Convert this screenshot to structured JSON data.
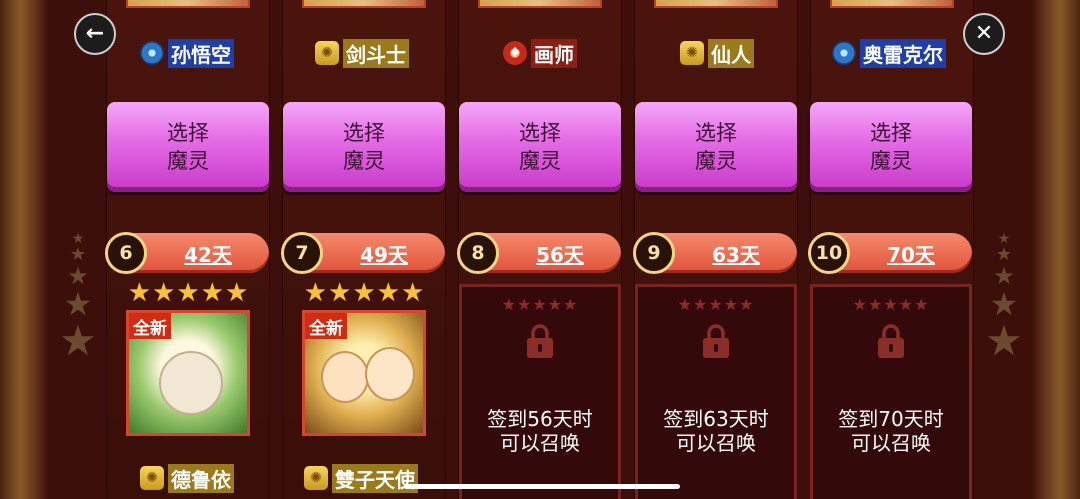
{
  "nav": {
    "back_icon": "←",
    "close_icon": "✕"
  },
  "top_heroes": [
    {
      "name": "孙悟空",
      "element": "water",
      "tint": "blue"
    },
    {
      "name": "剑斗士",
      "element": "light",
      "tint": "gold"
    },
    {
      "name": "画师",
      "element": "fire",
      "tint": "red"
    },
    {
      "name": "仙人",
      "element": "light",
      "tint": "gold"
    },
    {
      "name": "奥雷克尔",
      "element": "water",
      "tint": "blue"
    }
  ],
  "select_button": {
    "line1": "选择",
    "line2": "魔灵"
  },
  "days": [
    {
      "num": "6",
      "label": "42天"
    },
    {
      "num": "7",
      "label": "49天"
    },
    {
      "num": "8",
      "label": "56天"
    },
    {
      "num": "9",
      "label": "63天"
    },
    {
      "num": "10",
      "label": "70天"
    }
  ],
  "rewards": [
    {
      "badge": "全新",
      "stars": 5,
      "name": "德鲁依",
      "element": "light"
    },
    {
      "badge": "全新",
      "stars": 5,
      "name": "雙子天使",
      "element": "light"
    }
  ],
  "locked": [
    {
      "line1": "签到56天时",
      "line2": "可以召唤"
    },
    {
      "line1": "签到63天时",
      "line2": "可以召唤"
    },
    {
      "line1": "签到70天时",
      "line2": "可以召唤"
    }
  ],
  "colors": {
    "select_button": "#e56ee8",
    "day_pill": "#e0523a",
    "star": "#f5c23a",
    "badge": "#d42a10"
  }
}
